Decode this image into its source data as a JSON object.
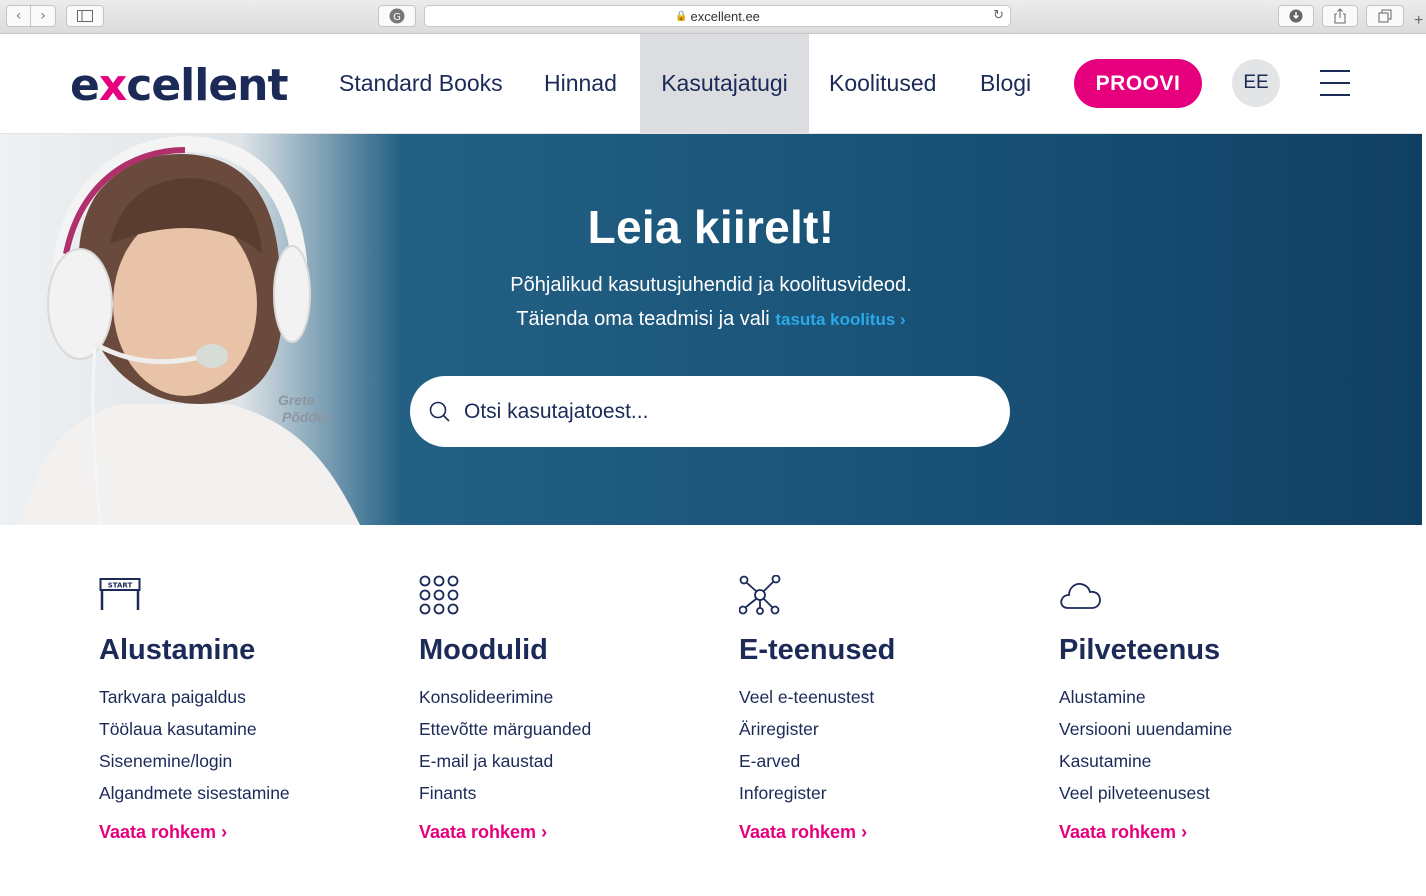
{
  "browser": {
    "url": "excellent.ee"
  },
  "header": {
    "logo_prefix": "e",
    "logo_x": "x",
    "logo_suffix": "cellent",
    "nav": [
      {
        "label": "Standard Books"
      },
      {
        "label": "Hinnad"
      },
      {
        "label": "Kasutajatugi"
      },
      {
        "label": "Koolitused"
      },
      {
        "label": "Blogi"
      }
    ],
    "cta_label": "PROOVI",
    "lang_label": "EE"
  },
  "hero": {
    "title": "Leia kiirelt!",
    "subtitle_line1": "Põhjalikud kasutusjuhendid ja koolitusvideod.",
    "subtitle_line2": "Täienda oma teadmisi ja vali",
    "link_text": "tasuta koolitus",
    "search_placeholder": "Otsi kasutajatoest...",
    "photo_caption_first": "Grete",
    "photo_caption_last": "Põdder"
  },
  "categories": [
    {
      "icon": "start-sign-icon",
      "title": "Alustamine",
      "links": [
        "Tarkvara paigaldus",
        "Töölaua kasutamine",
        "Sisenemine/login",
        "Algandmete sisestamine"
      ],
      "more": "Vaata rohkem"
    },
    {
      "icon": "modules-grid-icon",
      "title": "Moodulid",
      "links": [
        "Konsolideerimine",
        "Ettevõtte märguanded",
        "E-mail ja kaustad",
        "Finants"
      ],
      "more": "Vaata rohkem"
    },
    {
      "icon": "network-icon",
      "title": "E-teenused",
      "links": [
        "Veel e-teenustest",
        "Äriregister",
        "E-arved",
        "Inforegister"
      ],
      "more": "Vaata rohkem"
    },
    {
      "icon": "cloud-icon",
      "title": "Pilveteenus",
      "links": [
        "Alustamine",
        "Versiooni uuendamine",
        "Kasutamine",
        "Veel pilveteenusest"
      ],
      "more": "Vaata rohkem"
    }
  ],
  "colors": {
    "brand_navy": "#1b2a57",
    "brand_pink": "#e6007e",
    "hero_blue": "#174d72",
    "link_blue": "#2aa9e8"
  }
}
